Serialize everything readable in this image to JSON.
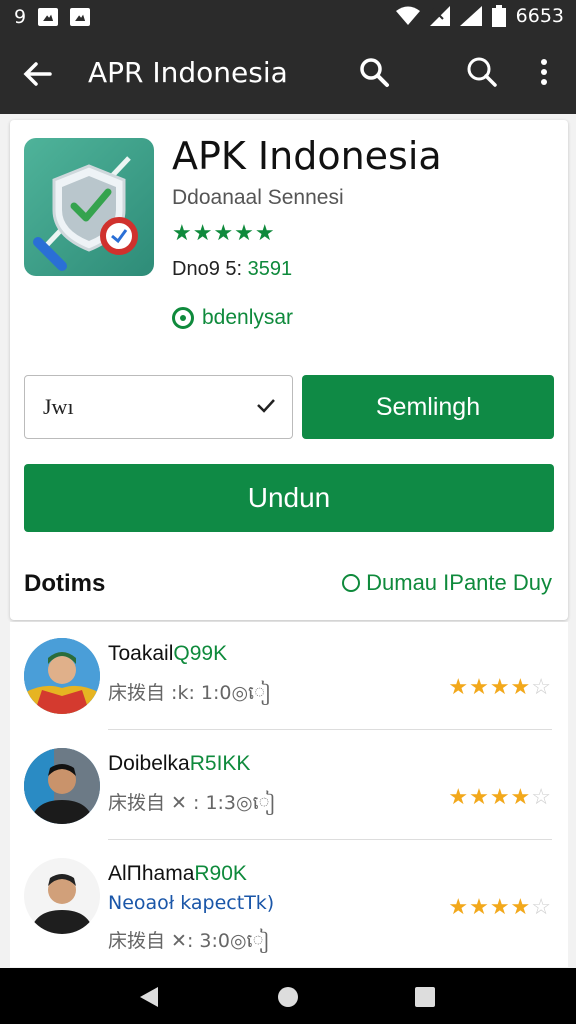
{
  "status_bar": {
    "left_icon_1": "9",
    "time": "6653",
    "icons": [
      "wifi-icon",
      "signal-icon",
      "battery-icon"
    ]
  },
  "app_bar": {
    "title": "APR Indonesia",
    "icons": [
      "back-arrow-icon",
      "search-icon",
      "search-icon",
      "more-vert-icon"
    ]
  },
  "app": {
    "name": "APK Indonesia",
    "developer": "Ddoanaal Sennesi",
    "stars": "★★★★★",
    "downloads_label": "Dno9 5:",
    "downloads_value": "3591",
    "verified_label": "bdenlysar",
    "dropdown_value": "Jwı",
    "secondary_button": "Semlingh",
    "download_button": "Undun"
  },
  "section": {
    "title": "Dotims",
    "link": "Dumau IPante Duy"
  },
  "reviews": [
    {
      "name": "Toakail",
      "count": "Q99K",
      "sub": "床拨自 :k: 1:0◎ៀ",
      "sub2": "",
      "rating": 4
    },
    {
      "name": "Doibelka",
      "count": "R5IKK",
      "sub": "床拨自 ✕ : 1:3◎ៀ",
      "sub2": "",
      "rating": 4
    },
    {
      "name": "AlΠhama",
      "count": "R90K",
      "sub": "Neoaoł kapectTk)",
      "sub2": "床拨自 ✕: 3:0◎ៀ",
      "rating": 4
    }
  ],
  "colors": {
    "accent": "#0f8a45",
    "star": "#f2a81b",
    "bar": "#2b2b2b"
  }
}
